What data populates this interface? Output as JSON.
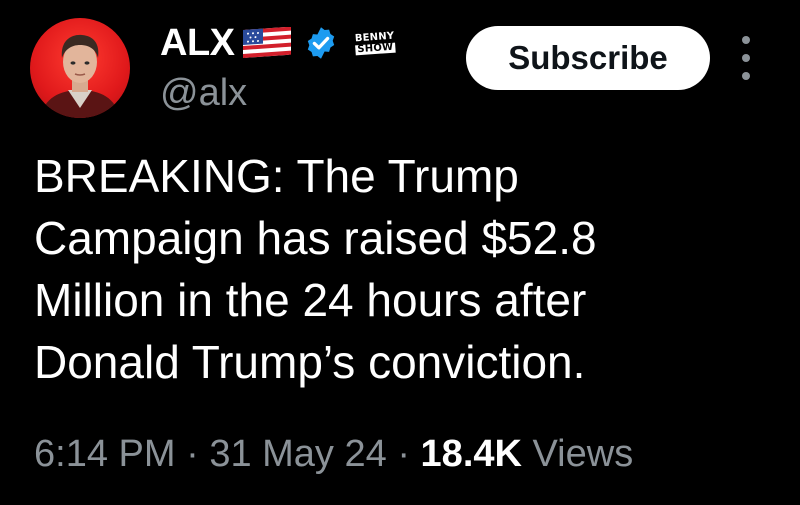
{
  "author": {
    "display_name": "ALX",
    "handle": "@alx",
    "badge_text_line1": "BENNY",
    "badge_text_line2": "SHOW"
  },
  "actions": {
    "subscribe_label": "Subscribe"
  },
  "tweet": {
    "lines": [
      "BREAKING: The Trump",
      "Campaign has raised $52.8",
      "Million in the 24 hours after",
      "Donald Trump’s conviction."
    ]
  },
  "meta": {
    "time": "6:14 PM",
    "sep1": " · ",
    "date": "31 May 24",
    "sep2": " · ",
    "views_count": "18.4K",
    "views_label": " Views"
  },
  "icons": {
    "flag": "us-flag-icon",
    "verified": "verified-badge-icon",
    "more": "more-options-icon"
  },
  "colors": {
    "background": "#000000",
    "text_primary": "#ffffff",
    "text_secondary": "#8b9298",
    "verified_blue": "#1d9bf0",
    "avatar_red": "#e0191b"
  }
}
